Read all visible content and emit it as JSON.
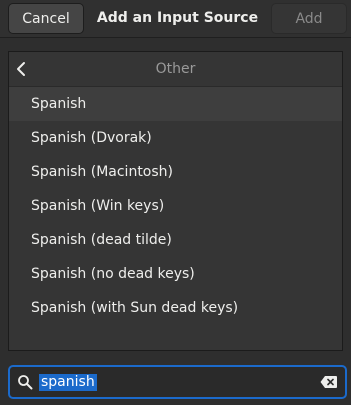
{
  "header": {
    "cancel_label": "Cancel",
    "title": "Add an Input Source",
    "add_label": "Add"
  },
  "list": {
    "title": "Other",
    "items": [
      {
        "label": "Spanish"
      },
      {
        "label": "Spanish (Dvorak)"
      },
      {
        "label": "Spanish (Macintosh)"
      },
      {
        "label": "Spanish (Win keys)"
      },
      {
        "label": "Spanish (dead tilde)"
      },
      {
        "label": "Spanish (no dead keys)"
      },
      {
        "label": "Spanish (with Sun dead keys)"
      }
    ],
    "selected_index": 0
  },
  "search": {
    "value": "spanish"
  },
  "icons": {
    "back": "chevron-left-icon",
    "search": "search-icon",
    "clear": "backspace-clear-icon"
  },
  "colors": {
    "accent": "#1b6acb",
    "background": "#2e2e2e",
    "list_background": "#353535"
  }
}
